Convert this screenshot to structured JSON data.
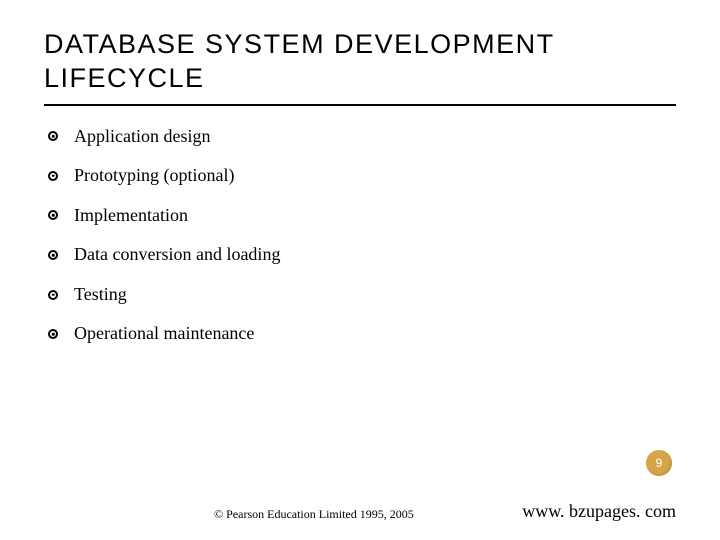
{
  "title": "DATABASE SYSTEM DEVELOPMENT LIFECYCLE",
  "bullets": [
    "Application design",
    "Prototyping (optional)",
    "Implementation",
    "Data conversion and loading",
    "Testing",
    "Operational maintenance"
  ],
  "page_number": "9",
  "copyright": "© Pearson Education Limited 1995, 2005",
  "site": "www. bzupages. com"
}
